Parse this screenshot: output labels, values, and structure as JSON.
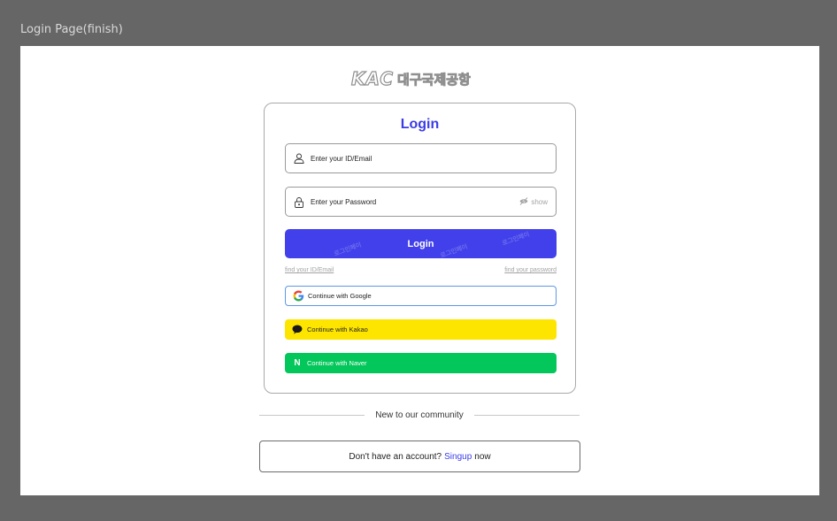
{
  "frame": {
    "title": "Login Page(finish)"
  },
  "logo": {
    "mark": "KAC",
    "text": "대구국제공항"
  },
  "card": {
    "title": "Login",
    "id_field": {
      "placeholder": "Enter your ID/Email",
      "icon": "user-icon"
    },
    "password_field": {
      "placeholder": "Enter your Password",
      "icon": "lock-icon",
      "toggle_label": "show",
      "toggle_icon": "eye-off-icon"
    },
    "login_button": {
      "label": "Login",
      "watermark": "로그인페이"
    },
    "links": {
      "find_id": "find your ID/Email",
      "find_password": "find your password"
    },
    "social": {
      "google": {
        "label": "Continue with Google",
        "icon": "google-icon"
      },
      "kakao": {
        "label": "Continue with Kakao",
        "icon": "kakao-chat-icon"
      },
      "naver": {
        "label": "Continue with Naver",
        "icon": "naver-n-icon",
        "glyph": "N"
      }
    }
  },
  "community": {
    "divider_text": "New to our community"
  },
  "signup": {
    "prefix": "Don't have an account?",
    "link": "Singup",
    "suffix": "now"
  },
  "colors": {
    "accent": "#4140ea",
    "kakao": "#fee500",
    "naver": "#03c75a",
    "google_border": "#5e98e6",
    "frame_bg": "#666666"
  }
}
